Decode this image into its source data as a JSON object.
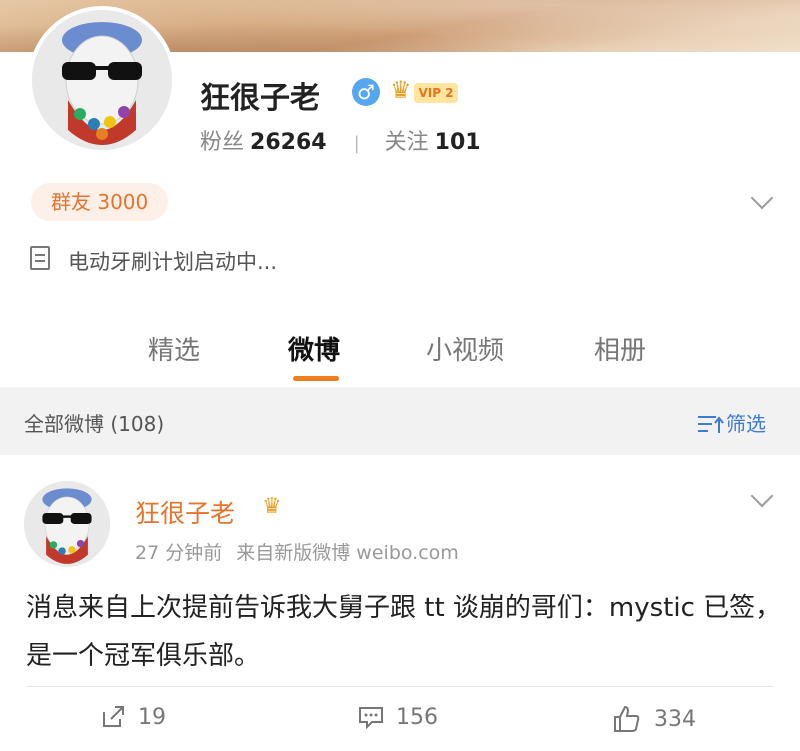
{
  "profile": {
    "name": "狂很子老",
    "gender_symbol": "♂",
    "vip_label": "VIP 2",
    "fans_label": "粉丝",
    "fans_count": "26264",
    "follow_label": "关注",
    "follow_count": "101",
    "group_chip": "群友 3000",
    "bio": "电动牙刷计划启动中..."
  },
  "tabs": [
    {
      "label": "精选"
    },
    {
      "label": "微博"
    },
    {
      "label": "小视频"
    },
    {
      "label": "相册"
    }
  ],
  "filter": {
    "label": "全部微博 (108)",
    "button": "筛选"
  },
  "post": {
    "author": "狂很子老",
    "time": "27 分钟前",
    "source": "来自新版微博 weibo.com",
    "text": "消息来自上次提前告诉我大舅子跟 tt 谈崩的哥们：mystic 已签，是一个冠军俱乐部。",
    "reposts": "19",
    "comments": "156",
    "likes": "334"
  },
  "icons": {
    "gender": "male-icon",
    "crown": "crown-icon",
    "bio": "document-icon",
    "filter": "filter-icon",
    "repost": "repost-icon",
    "comment": "comment-icon",
    "like": "thumbs-up-icon"
  },
  "colors": {
    "accent_orange": "#f07d1e",
    "link_blue": "#3e7bd2",
    "gender_blue": "#57a6f0"
  }
}
